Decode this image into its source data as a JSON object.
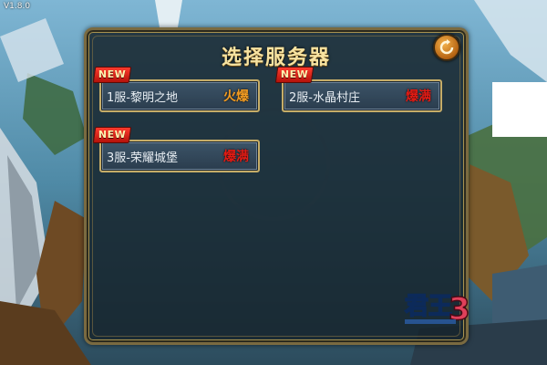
{
  "version": "V1.8.0",
  "dialog": {
    "title": "选择服务器"
  },
  "servers": [
    {
      "name": "1服-黎明之地",
      "status": "火爆",
      "badge": "NEW",
      "status_color": "#f29b22"
    },
    {
      "name": "2服-水晶村庄",
      "status": "爆满",
      "badge": "NEW",
      "status_color": "#e31b14"
    },
    {
      "name": "3服-荣耀城堡",
      "status": "爆满",
      "badge": "NEW",
      "status_color": "#e31b14"
    }
  ],
  "icons": {
    "refresh": "refresh-icon"
  },
  "logo": {
    "text": "君王3"
  },
  "colors": {
    "panel_border": "#a8924f",
    "title": "#f7e3a1",
    "status_hot": "#f29b22",
    "status_full": "#e31b14",
    "badge": "#d8221a"
  }
}
